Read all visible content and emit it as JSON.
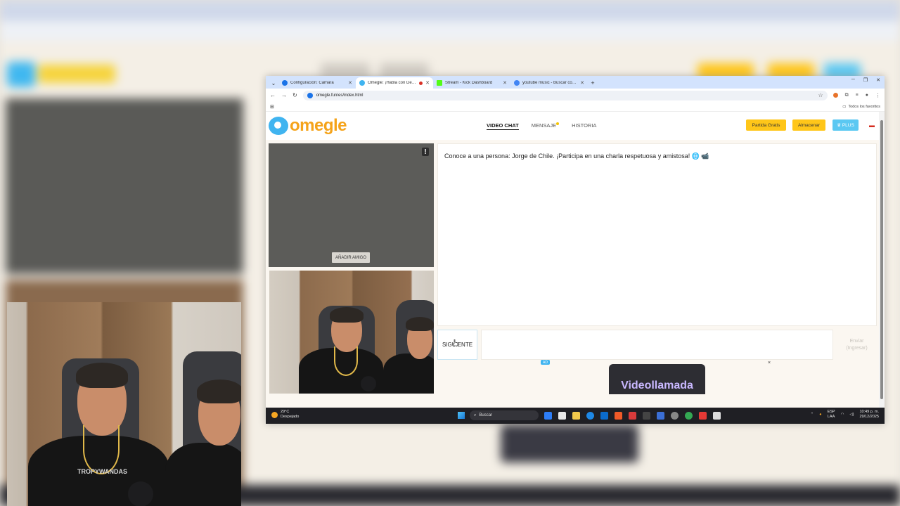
{
  "browser": {
    "tabs": [
      {
        "label": "Configuración: Cámara",
        "active": false,
        "favicon_color": "#1a73e8"
      },
      {
        "label": "Omegle: ¡Habla con Desco",
        "active": true,
        "favicon_color": "#40b4f0",
        "recording": true
      },
      {
        "label": "Stream - Kick Dashboard",
        "active": false,
        "favicon_color": "#53fc18"
      },
      {
        "label": "youtube music - Buscar con Go",
        "active": false,
        "favicon_color": "#4285f4"
      }
    ],
    "url": "omegle.fun/es/index.html",
    "bookmarks_all": "Todos los favoritos"
  },
  "site": {
    "logo_text": "omegle",
    "nav": {
      "video_chat": "VIDEO CHAT",
      "mensaje": "MENSAJE",
      "historia": "HISTORIA"
    },
    "buttons": {
      "partida_gratis": "Partida Gratis",
      "almacenar": "Almacenar",
      "plus": "PLUS"
    }
  },
  "video": {
    "warning": "!",
    "add_friend": "AÑADIR AMIGO"
  },
  "chat": {
    "message": "Conoce a una persona: Jorge de Chile. ¡Participa en una charla respetuosa y amistosa! 🌐 📹"
  },
  "controls": {
    "next": "SIGUIENTE",
    "send_line1": "Enviar",
    "send_line2": "(Ingresar)"
  },
  "ad": {
    "badge": "AD",
    "close": "×",
    "title": "Videollamada"
  },
  "taskbar": {
    "temperature": "29°C",
    "weather": "Despejado",
    "search": "Buscar",
    "lang_line1": "ESP",
    "lang_line2": "LAA",
    "time": "10:49 p. m.",
    "date": "29/12/2025"
  },
  "overlay": {
    "shirt_text": "TROPYWANDAS"
  }
}
